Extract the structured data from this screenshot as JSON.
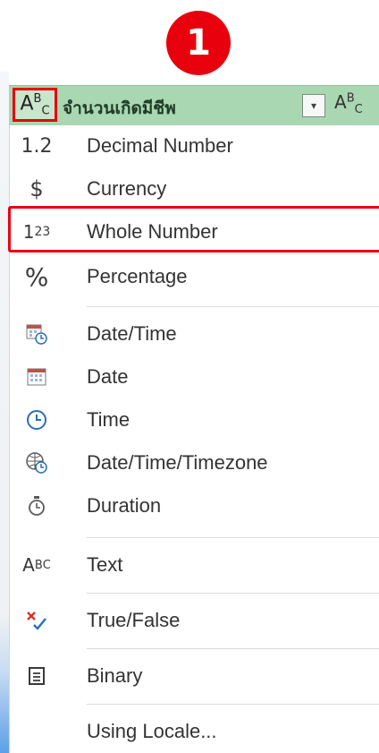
{
  "step_badge": "1",
  "column_header": {
    "type_icon_text": "ABC",
    "name": "จำนวนเกิดมีชีพ",
    "filter_glyph": "▾",
    "next_column_type_icon": "ABC"
  },
  "menu": {
    "items": [
      {
        "icon": "decimal-icon",
        "glyph": "1.2",
        "label": "Decimal Number"
      },
      {
        "icon": "currency-icon",
        "glyph": "$",
        "label": "Currency"
      },
      {
        "icon": "whole-number-icon",
        "glyph": "1²₃",
        "label": "Whole Number"
      },
      {
        "icon": "percent-icon",
        "glyph": "%",
        "label": "Percentage"
      },
      {
        "icon": "datetime-icon",
        "glyph": "",
        "label": "Date/Time"
      },
      {
        "icon": "date-icon",
        "glyph": "",
        "label": "Date"
      },
      {
        "icon": "time-icon",
        "glyph": "",
        "label": "Time"
      },
      {
        "icon": "datetimezone-icon",
        "glyph": "",
        "label": "Date/Time/Timezone"
      },
      {
        "icon": "duration-icon",
        "glyph": "⏱",
        "label": "Duration"
      },
      {
        "icon": "text-icon",
        "glyph": "ABC",
        "label": "Text"
      },
      {
        "icon": "true-false-icon",
        "glyph": "",
        "label": "True/False"
      },
      {
        "icon": "binary-icon",
        "glyph": "",
        "label": "Binary"
      },
      {
        "icon": "",
        "glyph": "",
        "label": "Using Locale..."
      }
    ]
  },
  "colors": {
    "highlight": "#e8000d",
    "header_bg": "#a9d7b2"
  }
}
